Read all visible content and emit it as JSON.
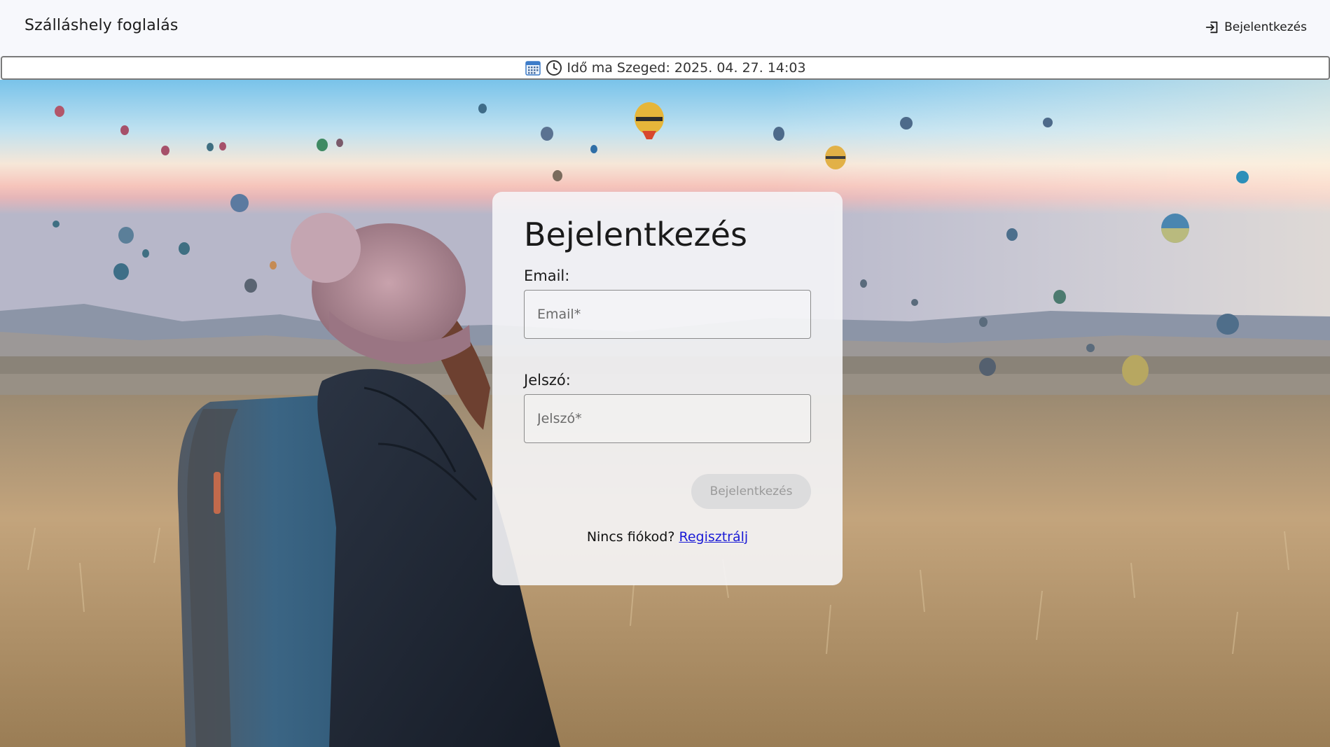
{
  "header": {
    "brand": "Szálláshely foglalás",
    "login_link": "Bejelentkezés"
  },
  "timebar": {
    "text": "Idő ma Szeged: 2025. 04. 27. 14:03",
    "icons": [
      "calendar-icon",
      "clock-icon"
    ]
  },
  "login_card": {
    "title": "Bejelentkezés",
    "email_label": "Email:",
    "email_placeholder": "Email*",
    "email_value": "",
    "password_label": "Jelszó:",
    "password_placeholder": "Jelszó*",
    "password_value": "",
    "submit_label": "Bejelentkezés",
    "signup_prompt": "Nincs fiókod?",
    "signup_link": "Regisztrálj"
  },
  "colors": {
    "link": "#1a1ad6",
    "disabled_button_bg": "#dcdcdd",
    "disabled_button_text": "#9a9a9a"
  }
}
